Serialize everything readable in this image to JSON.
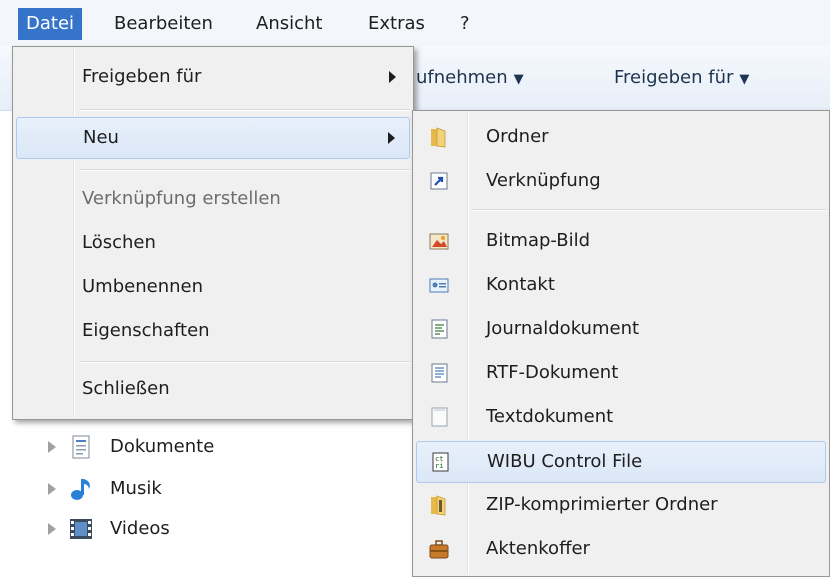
{
  "menubar": {
    "items": [
      {
        "label": "Datei",
        "active": true
      },
      {
        "label": "Bearbeiten"
      },
      {
        "label": "Ansicht"
      },
      {
        "label": "Extras"
      },
      {
        "label": "?"
      }
    ]
  },
  "toolbar": {
    "items": [
      {
        "label": "ufnehmen",
        "caret": "▼"
      },
      {
        "label": "Freigeben für",
        "caret": "▼"
      }
    ]
  },
  "tree": {
    "items": [
      {
        "label": "Dokumente",
        "icon": "documents-icon"
      },
      {
        "label": "Musik",
        "icon": "music-icon"
      },
      {
        "label": "Videos",
        "icon": "videos-icon"
      }
    ]
  },
  "file_menu": {
    "items": [
      {
        "label": "Freigeben für",
        "submenu": true
      },
      {
        "label": "Neu",
        "submenu": true,
        "highlighted": true
      },
      {
        "label": "Verknüpfung erstellen",
        "disabled": true
      },
      {
        "label": "Löschen"
      },
      {
        "label": "Umbenennen"
      },
      {
        "label": "Eigenschaften"
      },
      {
        "label": "Schließen"
      }
    ]
  },
  "new_submenu": {
    "items": [
      {
        "label": "Ordner",
        "icon": "folder-icon"
      },
      {
        "label": "Verknüpfung",
        "icon": "shortcut-icon"
      },
      {
        "label": "Bitmap-Bild",
        "icon": "bitmap-icon"
      },
      {
        "label": "Kontakt",
        "icon": "contact-icon"
      },
      {
        "label": "Journaldokument",
        "icon": "journal-icon"
      },
      {
        "label": "RTF-Dokument",
        "icon": "rtf-document-icon"
      },
      {
        "label": "Textdokument",
        "icon": "text-document-icon"
      },
      {
        "label": "WIBU Control File",
        "icon": "wibu-file-icon",
        "highlighted": true
      },
      {
        "label": "ZIP-komprimierter Ordner",
        "icon": "zip-folder-icon"
      },
      {
        "label": "Aktenkoffer",
        "icon": "briefcase-icon"
      }
    ]
  },
  "colors": {
    "menu_bg": "#f0f0f0",
    "highlight": "#dbe7f7",
    "menubar_active": "#3574c9"
  }
}
